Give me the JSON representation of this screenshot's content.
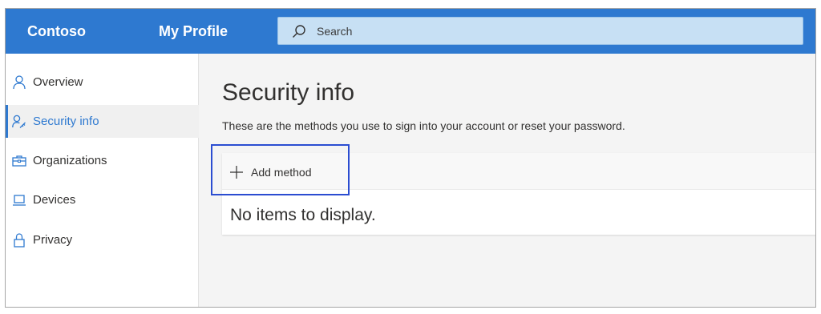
{
  "header": {
    "brand": "Contoso",
    "app_title": "My Profile",
    "search": {
      "placeholder": "Search",
      "icon": "search-icon"
    }
  },
  "sidebar": {
    "items": [
      {
        "label": "Overview",
        "icon": "person-icon",
        "active": false
      },
      {
        "label": "Security info",
        "icon": "person-key-icon",
        "active": true
      },
      {
        "label": "Organizations",
        "icon": "briefcase-icon",
        "active": false
      },
      {
        "label": "Devices",
        "icon": "laptop-icon",
        "active": false
      },
      {
        "label": "Privacy",
        "icon": "lock-icon",
        "active": false
      }
    ]
  },
  "main": {
    "title": "Security info",
    "description": "These are the methods you use to sign into your account or reset your password.",
    "add_method_label": "Add method",
    "empty_message": "No items to display."
  },
  "colors": {
    "brand_blue": "#2e79d0",
    "search_bg": "#c7e0f4",
    "highlight_border": "#2b4dd1"
  }
}
